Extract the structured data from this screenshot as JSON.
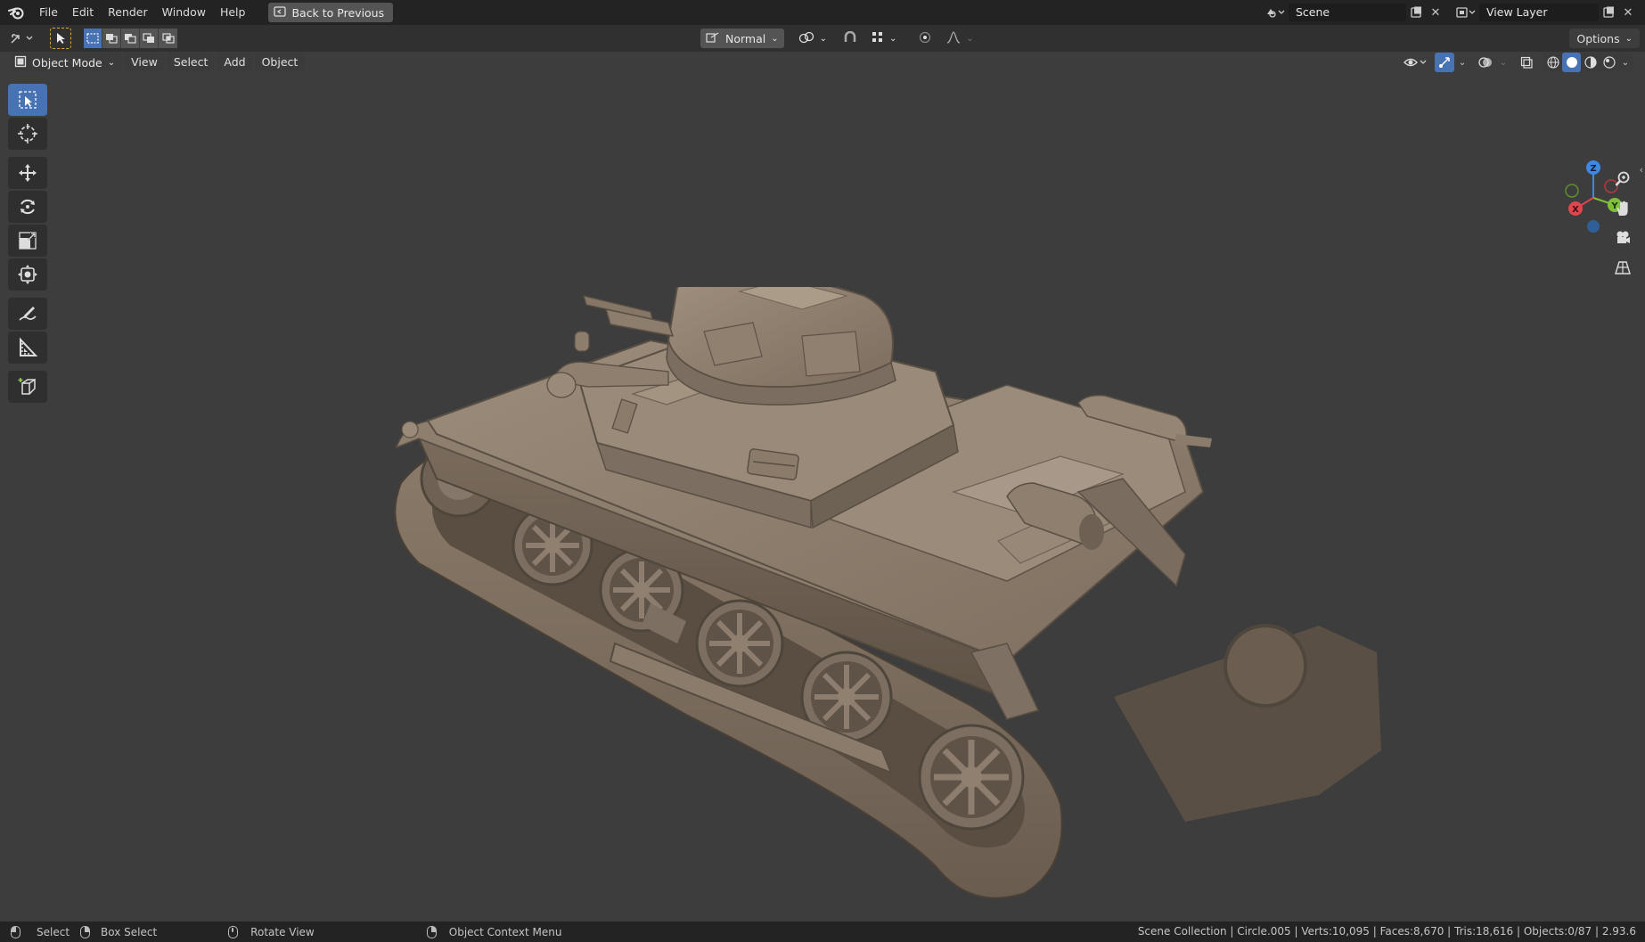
{
  "topbar": {
    "menus": [
      "File",
      "Edit",
      "Render",
      "Window",
      "Help"
    ],
    "back_button": "Back to Previous",
    "scene_name": "Scene",
    "view_layer_name": "View Layer"
  },
  "tool_header": {
    "transform_orientation": "Normal",
    "options_label": "Options"
  },
  "viewport_header": {
    "mode": "Object Mode",
    "menus": [
      "View",
      "Select",
      "Add",
      "Object"
    ]
  },
  "toolbar": {
    "tools": [
      "select-box",
      "cursor",
      "move",
      "rotate",
      "scale",
      "transform",
      "annotate",
      "measure",
      "add-cube"
    ],
    "active_tool": "select-box"
  },
  "gizmo": {
    "axis_labels": [
      "Z",
      "Y",
      "X"
    ],
    "axis_colors": {
      "x": "#e0444f",
      "y": "#7fbf3a",
      "z": "#3f87e6"
    }
  },
  "statusbar": {
    "select": "Select",
    "box_select": "Box Select",
    "rotate_view": "Rotate View",
    "context_menu": "Object Context Menu",
    "stats": "Scene Collection | Circle.005 | Verts:10,095 | Faces:8,670 | Tris:18,616 | Objects:0/87 | 2.93.6"
  },
  "colors": {
    "accent": "#4772b3",
    "viewport_bg": "#3d3d3d",
    "model": "#8a7b6b"
  }
}
